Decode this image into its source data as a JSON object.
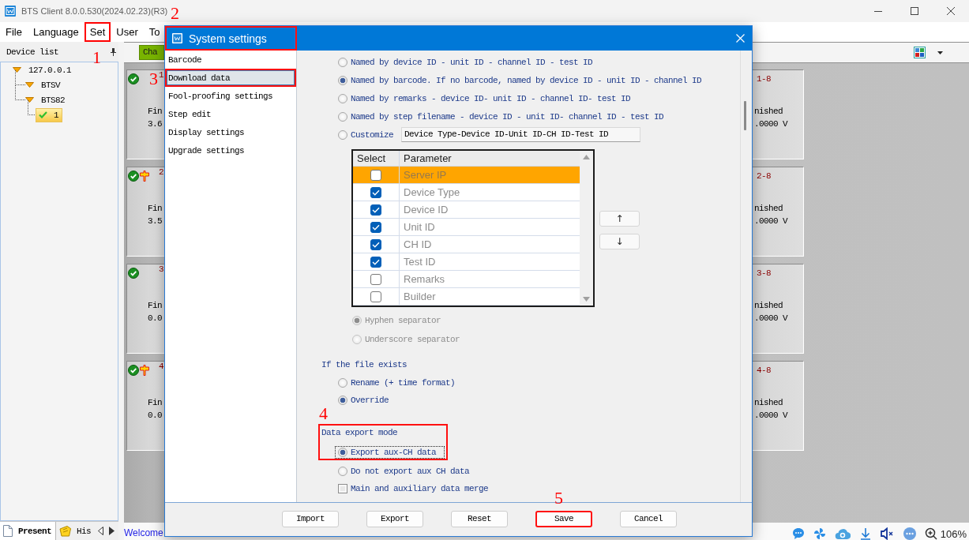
{
  "window": {
    "title": "BTS Client 8.0.0.530(2024.02.23)(R3)"
  },
  "menu": [
    {
      "label": "File",
      "boxed": false
    },
    {
      "label": "Language",
      "boxed": false
    },
    {
      "label": "Set",
      "boxed": true
    },
    {
      "label": "User",
      "boxed": false
    },
    {
      "label": "To",
      "boxed": false
    }
  ],
  "device_list": {
    "title": "Device list",
    "tree": [
      {
        "label": "127.0.0.1",
        "kind": "node",
        "expanded": true,
        "children": [
          {
            "label": "BTSV",
            "kind": "node",
            "expanded": true
          },
          {
            "label": "BTS82",
            "kind": "node",
            "expanded": true,
            "children": [
              {
                "label": "1",
                "kind": "channel",
                "selected": true
              }
            ]
          }
        ]
      }
    ]
  },
  "panel_tabs": [
    {
      "label": "Present",
      "selected": true
    },
    {
      "label": "His",
      "selected": false
    }
  ],
  "toolbar": {
    "button": "Cha"
  },
  "channel_rows": [
    {
      "first": {
        "label": "1",
        "status": "Fin",
        "value": "3.6",
        "flagged": false
      },
      "last": {
        "label": "1-8",
        "status": "nished",
        "value": ".0000 V"
      }
    },
    {
      "first": {
        "label": "2",
        "status": "Fin",
        "value": "3.5",
        "flagged": true
      },
      "last": {
        "label": "2-8",
        "status": "nished",
        "value": ".0000 V"
      }
    },
    {
      "first": {
        "label": "3",
        "status": "Fin",
        "value": "0.0",
        "flagged": false
      },
      "last": {
        "label": "3-8",
        "status": "nished",
        "value": ".0000 V"
      }
    },
    {
      "first": {
        "label": "4",
        "status": "Fin",
        "value": "0.0",
        "flagged": true
      },
      "last": {
        "label": "4-8",
        "status": "nished",
        "value": ".0000 V"
      }
    }
  ],
  "status_bar": {
    "message": "Welcome",
    "zoom": "106%"
  },
  "dialog": {
    "title": "System settings",
    "boxed": true,
    "nav": [
      {
        "label": "Barcode",
        "selected": false,
        "boxed": false
      },
      {
        "label": "Download data",
        "selected": true,
        "boxed": true
      },
      {
        "label": "Fool-proofing settings",
        "selected": false,
        "boxed": false
      },
      {
        "label": "Step edit",
        "selected": false,
        "boxed": false
      },
      {
        "label": "Display settings",
        "selected": false,
        "boxed": false
      },
      {
        "label": "Upgrade settings",
        "selected": false,
        "boxed": false
      }
    ],
    "naming": [
      {
        "kind": "preset",
        "label": "Named by device ID - unit ID - channel ID - test ID",
        "selected": false
      },
      {
        "kind": "preset",
        "label": "Named by barcode. If no barcode, named by device ID - unit ID - channel ID",
        "selected": true
      },
      {
        "kind": "preset",
        "label": "Named by remarks - device ID- unit ID - channel ID- test ID",
        "selected": false
      },
      {
        "kind": "preset",
        "label": "Named by step filename - device ID - unit ID- channel ID - test ID",
        "selected": false
      },
      {
        "kind": "custom",
        "label": "Customize",
        "selected": false,
        "value": "Device Type-Device ID-Unit ID-CH ID-Test ID"
      }
    ],
    "parameters": {
      "columns": [
        "Select",
        "Parameter"
      ],
      "rows": [
        {
          "name": "Server IP",
          "checked": false,
          "selected": true
        },
        {
          "name": "Device Type",
          "checked": true,
          "selected": false
        },
        {
          "name": "Device ID",
          "checked": true,
          "selected": false
        },
        {
          "name": "Unit ID",
          "checked": true,
          "selected": false
        },
        {
          "name": "CH ID",
          "checked": true,
          "selected": false
        },
        {
          "name": "Test ID",
          "checked": true,
          "selected": false
        },
        {
          "name": "Remarks",
          "checked": false,
          "selected": false
        },
        {
          "name": "Builder",
          "checked": false,
          "selected": false
        }
      ]
    },
    "move_buttons": [
      "↑",
      "↓"
    ],
    "separators": [
      {
        "label": "Hyphen separator",
        "selected": true,
        "disabled": true
      },
      {
        "label": "Underscore separator",
        "selected": false,
        "disabled": true
      }
    ],
    "file_exists": {
      "title": "If the file exists",
      "options": [
        {
          "label": "Rename (+ time format)",
          "selected": false
        },
        {
          "label": "Override",
          "selected": true
        }
      ]
    },
    "export_mode": {
      "title": "Data export mode",
      "options": [
        {
          "label": "Export aux-CH data",
          "selected": true,
          "boxed": true,
          "focused": true
        },
        {
          "label": "Do not export aux CH data",
          "selected": false,
          "boxed": false,
          "focused": false
        }
      ],
      "merge": {
        "label": "Main and auxiliary data merge",
        "checked": false
      }
    },
    "buttons": [
      {
        "label": "Import",
        "boxed": false
      },
      {
        "label": "Export",
        "boxed": false
      },
      {
        "label": "Reset",
        "boxed": false
      },
      {
        "label": "Save",
        "boxed": true
      },
      {
        "label": "Cancel",
        "boxed": false
      }
    ]
  },
  "callouts": [
    "1",
    "2",
    "3",
    "4",
    "5"
  ]
}
